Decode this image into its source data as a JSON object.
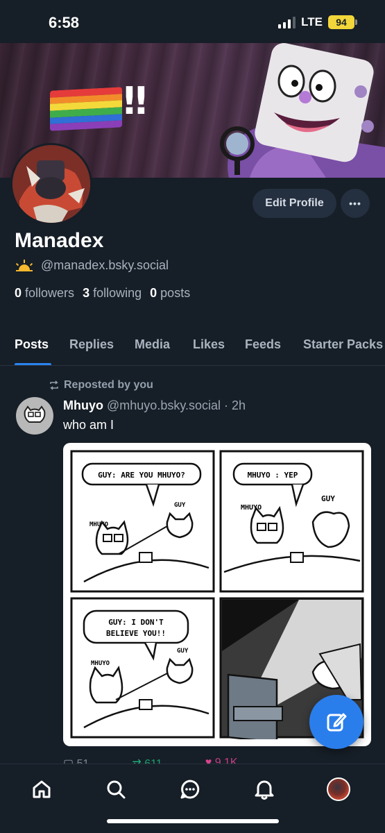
{
  "status_bar": {
    "time": "6:58",
    "network": "LTE",
    "battery": "94"
  },
  "banner": {
    "emoji_text": "‼"
  },
  "profile": {
    "edit_label": "Edit Profile",
    "more_label": "•••",
    "display_name": "Manadex",
    "handle": "@manadex.bsky.social",
    "followers_count": "0",
    "followers_label": "followers",
    "following_count": "3",
    "following_label": "following",
    "posts_count": "0",
    "posts_label": "posts"
  },
  "tabs": [
    {
      "label": "Posts",
      "active": true
    },
    {
      "label": "Replies"
    },
    {
      "label": "Media"
    },
    {
      "label": "Likes"
    },
    {
      "label": "Feeds"
    },
    {
      "label": "Starter Packs"
    }
  ],
  "post": {
    "repost_label": "Reposted by you",
    "author": "Mhuyo",
    "handle": "@mhuyo.bsky.social",
    "time": "· 2h",
    "text": "who am I",
    "comic": {
      "panel1_bubble": "GUY: ARE YOU MHUYO?",
      "panel1_label_a": "MHUYO",
      "panel1_label_b": "GUY",
      "panel2_bubble": "MHUYO : YEP",
      "panel2_label_a": "MHUYO",
      "panel2_label_b": "GUY",
      "panel3_bubble_line1": "GUY: I DON'T",
      "panel3_bubble_line2": "BELIEVE YOU!!",
      "panel3_label_a": "MHUYO",
      "panel3_label_b": "GUY"
    },
    "replies": "51",
    "reposts": "611",
    "likes": "9.1K"
  },
  "colors": {
    "accent": "#2a7eec",
    "background": "#161e27",
    "like": "#ec4899",
    "repost": "#20bc82"
  },
  "nav": [
    "home-icon",
    "search-icon",
    "chat-icon",
    "bell-icon",
    "profile-avatar"
  ]
}
